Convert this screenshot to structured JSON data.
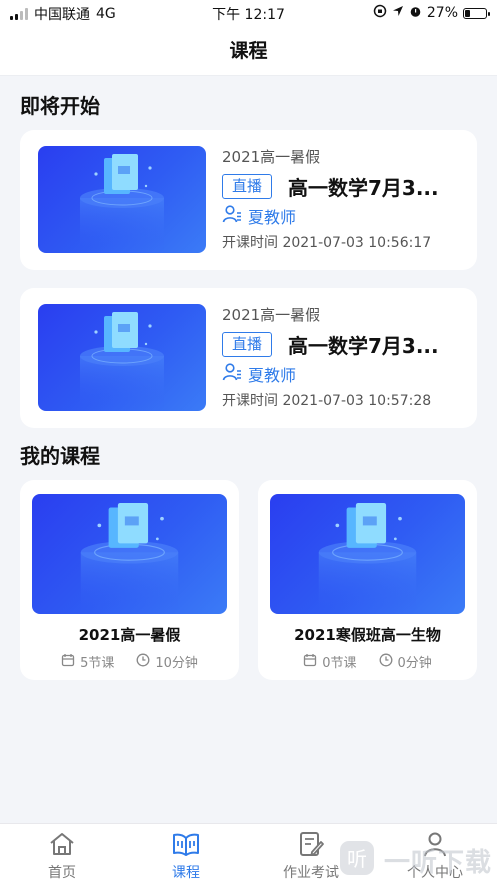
{
  "status_bar": {
    "carrier": "中国联通",
    "network": "4G",
    "time": "下午 12:17",
    "battery": "27%",
    "battery_level": 0.27
  },
  "header": {
    "title": "课程"
  },
  "upcoming": {
    "title": "即将开始",
    "cards": [
      {
        "subtitle": "2021高一暑假",
        "badge": "直播",
        "course_name": "高一数学7月3...",
        "teacher": "夏教师",
        "start_time": "开课时间 2021-07-03 10:56:17"
      },
      {
        "subtitle": "2021高一暑假",
        "badge": "直播",
        "course_name": "高一数学7月3...",
        "teacher": "夏教师",
        "start_time": "开课时间 2021-07-03 10:57:28"
      }
    ]
  },
  "my_courses": {
    "title": "我的课程",
    "cards": [
      {
        "title": "2021高一暑假",
        "lessons": "5节课",
        "duration": "10分钟"
      },
      {
        "title": "2021寒假班高一生物",
        "lessons": "0节课",
        "duration": "0分钟"
      }
    ]
  },
  "tabs": [
    {
      "label": "首页",
      "icon": "home-icon",
      "active": false
    },
    {
      "label": "课程",
      "icon": "book-icon",
      "active": true
    },
    {
      "label": "作业考试",
      "icon": "edit-icon",
      "active": false
    },
    {
      "label": "个人中心",
      "icon": "user-icon",
      "active": false
    }
  ],
  "watermark": {
    "text": "一听下载"
  },
  "colors": {
    "accent": "#2f7be9",
    "thumb_blue": "#2f5cf3",
    "background": "#f3f5f9"
  }
}
